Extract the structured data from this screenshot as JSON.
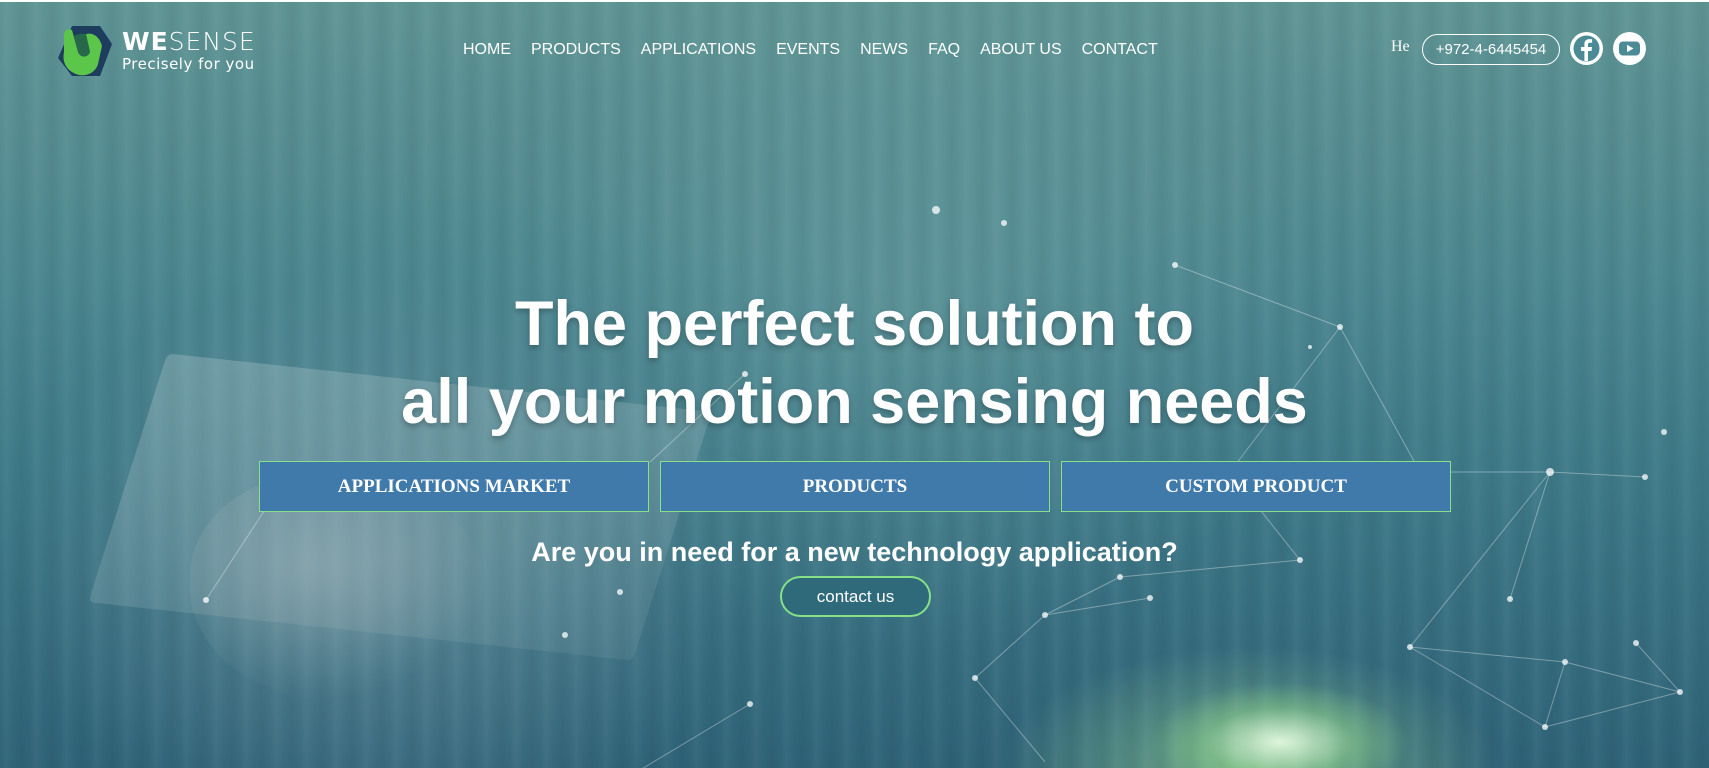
{
  "brand": {
    "name_bold": "WE",
    "name_light": "SENSE",
    "tagline": "Precisely for you"
  },
  "nav": {
    "items": [
      {
        "label": "HOME"
      },
      {
        "label": "PRODUCTS"
      },
      {
        "label": "APPLICATIONS"
      },
      {
        "label": "EVENTS"
      },
      {
        "label": "NEWS"
      },
      {
        "label": "FAQ"
      },
      {
        "label": "ABOUT US"
      },
      {
        "label": "CONTACT"
      }
    ]
  },
  "header": {
    "language": "He",
    "phone": "+972-4-6445454",
    "social": [
      {
        "icon": "facebook-icon"
      },
      {
        "icon": "youtube-icon"
      }
    ]
  },
  "hero": {
    "headline_line1": "The perfect solution to",
    "headline_line2": "all your motion sensing needs",
    "buttons": [
      {
        "label": "APPLICATIONS MARKET"
      },
      {
        "label": "PRODUCTS"
      },
      {
        "label": "CUSTOM PRODUCT"
      }
    ],
    "subline": "Are you in need for a new technology application?",
    "contact_label": "contact us"
  },
  "colors": {
    "accent_green": "#86e08a",
    "button_blue": "#3f7aaa",
    "logo_green": "#5cc64a",
    "logo_navy": "#1d3c5e"
  }
}
